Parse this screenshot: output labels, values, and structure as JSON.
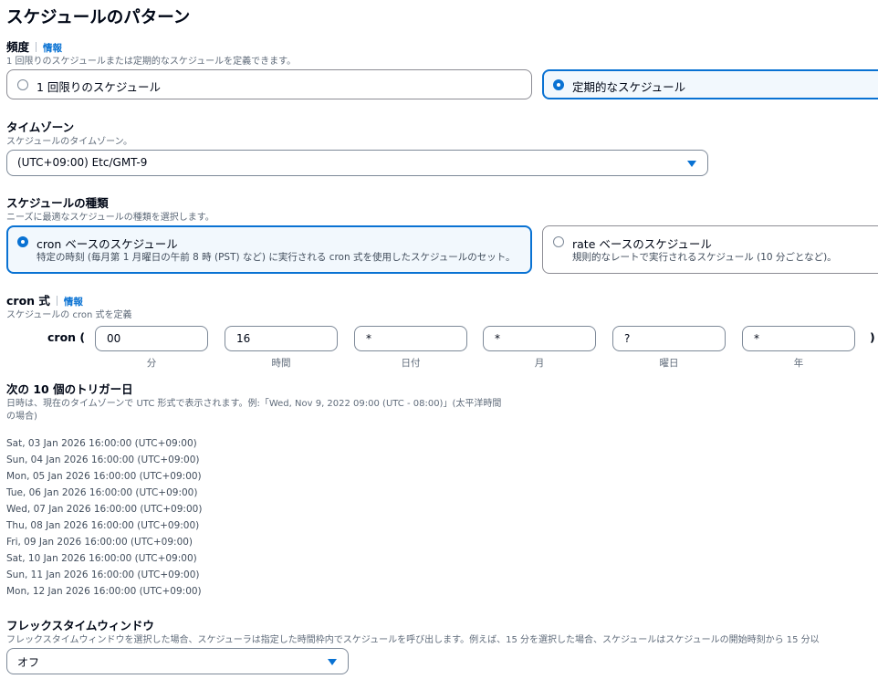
{
  "page_title": "スケジュールのパターン",
  "frequency": {
    "label": "頻度",
    "info": "情報",
    "description": "1 回限りのスケジュールまたは定期的なスケジュールを定義できます。",
    "options": [
      "1 回限りのスケジュール",
      "定期的なスケジュール"
    ],
    "selected": "定期的なスケジュール"
  },
  "timezone": {
    "label": "タイムゾーン",
    "description": "スケジュールのタイムゾーン。",
    "value": "(UTC+09:00) Etc/GMT-9"
  },
  "schedule_type": {
    "label": "スケジュールの種類",
    "description": "ニーズに最適なスケジュールの種類を選択します。",
    "options": [
      {
        "title": "cron ベースのスケジュール",
        "sub": "特定の時刻 (毎月第 1 月曜日の午前 8 時 (PST) など) に実行される cron 式を使用したスケジュールのセット。"
      },
      {
        "title": "rate ベースのスケジュール",
        "sub": "規則的なレートで実行されるスケジュール (10 分ごとなど)。"
      }
    ],
    "selected": "cron ベースのスケジュール"
  },
  "cron": {
    "label": "cron 式",
    "info": "情報",
    "description": "スケジュールの cron 式を定義",
    "prefix": "cron (",
    "suffix": ")",
    "fields": [
      {
        "value": "00",
        "caption": "分"
      },
      {
        "value": "16",
        "caption": "時間"
      },
      {
        "value": "*",
        "caption": "日付"
      },
      {
        "value": "*",
        "caption": "月"
      },
      {
        "value": "?",
        "caption": "曜日"
      },
      {
        "value": "*",
        "caption": "年"
      }
    ]
  },
  "triggers": {
    "label": "次の 10 個のトリガー日",
    "description_line1": "日時は、現在のタイムゾーンで UTC 形式で表示されます。例:「Wed, Nov 9, 2022 09:00 (UTC - 08:00)」(太平洋時間",
    "description_line2": "の場合)",
    "dates": [
      "Sat, 03 Jan 2026 16:00:00 (UTC+09:00)",
      "Sun, 04 Jan 2026 16:00:00 (UTC+09:00)",
      "Mon, 05 Jan 2026 16:00:00 (UTC+09:00)",
      "Tue, 06 Jan 2026 16:00:00 (UTC+09:00)",
      "Wed, 07 Jan 2026 16:00:00 (UTC+09:00)",
      "Thu, 08 Jan 2026 16:00:00 (UTC+09:00)",
      "Fri, 09 Jan 2026 16:00:00 (UTC+09:00)",
      "Sat, 10 Jan 2026 16:00:00 (UTC+09:00)",
      "Sun, 11 Jan 2026 16:00:00 (UTC+09:00)",
      "Mon, 12 Jan 2026 16:00:00 (UTC+09:00)"
    ]
  },
  "flex_window": {
    "label": "フレックスタイムウィンドウ",
    "description": "フレックスタイムウィンドウを選択した場合、スケジューラは指定した時間枠内でスケジュールを呼び出します。例えば、15 分を選択した場合、スケジュールはスケジュールの開始時刻から 15 分以",
    "value": "オフ"
  },
  "colors": {
    "accent": "#0972d3",
    "selected_bg": "#f2f8fd",
    "text": "#000716",
    "muted": "#5f6b7a"
  },
  "icons": {
    "select_caret": "caret-down-icon"
  }
}
